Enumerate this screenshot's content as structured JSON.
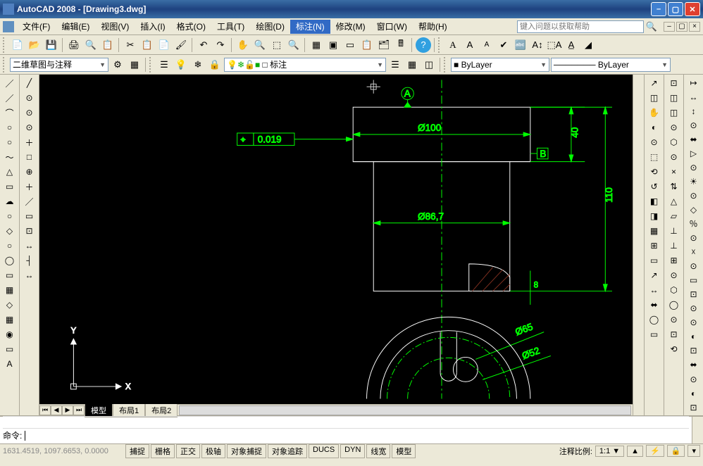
{
  "title": "AutoCAD 2008 - [Drawing3.dwg]",
  "menu": {
    "items": [
      "文件(F)",
      "编辑(E)",
      "视图(V)",
      "插入(I)",
      "格式(O)",
      "工具(T)",
      "绘图(D)",
      "标注(N)",
      "修改(M)",
      "窗口(W)",
      "帮助(H)"
    ],
    "active_index": 7,
    "help_placeholder": "键入问题以获取帮助"
  },
  "toolbar2": {
    "workspace": "二维草图与注释",
    "layer_combo": "□ 标注",
    "bylayer": "ByLayer",
    "linetype": "ByLayer"
  },
  "text_toolbar": {
    "a1": "A",
    "a2": "A",
    "a3": "A"
  },
  "drawing": {
    "tolerance": "0.019",
    "dim_d100": "Ø100",
    "dim_40": "40",
    "dim_110": "110",
    "dim_8": "8",
    "dim_d867": "Ø86,7",
    "dim_d65": "Ø65",
    "dim_d52": "Ø52",
    "datum_a": "A",
    "datum_b": "B",
    "ucs_x": "X",
    "ucs_y": "Y"
  },
  "tabs": {
    "model": "模型",
    "layout1": "布局1",
    "layout2": "布局2"
  },
  "cmd": {
    "prompt": "命令:"
  },
  "status": {
    "coords": "1631.4519, 1097.6653, 0.0000",
    "btns": [
      "捕捉",
      "栅格",
      "正交",
      "极轴",
      "对象捕捉",
      "对象追踪",
      "DUCS",
      "DYN",
      "线宽",
      "模型"
    ],
    "scale_label": "注释比例:",
    "scale_value": "1:1"
  },
  "left_tools": [
    "／",
    "／",
    "⌒",
    "○",
    "○",
    "～",
    "△",
    "▭",
    "☁",
    "○",
    "◇",
    "○",
    "◯",
    "▭",
    "▦",
    "◇",
    "▦",
    "◉",
    "▭",
    "A"
  ],
  "left_tools2": [
    "╱",
    "⊙",
    "⊙",
    "⊙",
    "＋",
    "□",
    "⊕",
    "＋",
    "／",
    "▭",
    "⊡",
    "↔",
    "┤",
    "↔"
  ],
  "right_tools": [
    "↗",
    "◫",
    "✋",
    "◐",
    "⊙",
    "⬚",
    "⟲",
    "↺",
    "◧",
    "◨",
    "▦",
    "⊞",
    "▭",
    "↗",
    "↔",
    "⬌",
    "◯",
    "▭"
  ],
  "right_tools2": [
    "⊡",
    "◫",
    "◫",
    "⊙",
    "⬡",
    "⊙",
    "×",
    "⇅",
    "△",
    "▱",
    "⊥",
    "⊥",
    "⊞",
    "⊙",
    "⬡",
    "◯",
    "⊙",
    "⊡",
    "⟲"
  ],
  "right_tools3": [
    "↦",
    "↔",
    "↕",
    "⊙",
    "⬌",
    "▷",
    "⊙",
    "☀",
    "⊙",
    "◇",
    "％",
    "⊙",
    "☓",
    "⊙",
    "▭",
    "⊡",
    "⊙",
    "⊙",
    "◐",
    "⊡",
    "⬌",
    "⊙",
    "◐",
    "⊡"
  ]
}
